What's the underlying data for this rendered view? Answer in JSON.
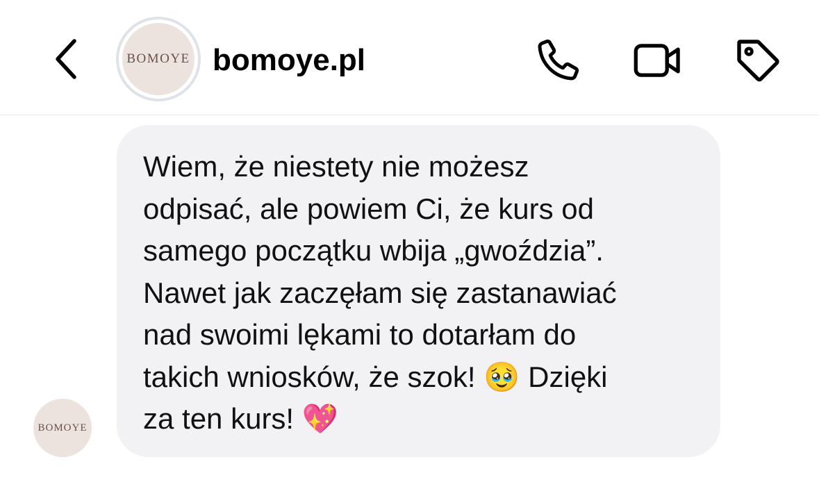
{
  "header": {
    "back_icon": "chevron-left-icon",
    "avatar_logo": "BOMOYE",
    "username": "bomoye.pl",
    "actions": [
      {
        "icon": "phone-icon"
      },
      {
        "icon": "video-camera-icon"
      },
      {
        "icon": "tag-icon"
      }
    ]
  },
  "conversation": {
    "sender_avatar_logo": "BOMOYE",
    "message": {
      "lines": [
        "Wiem, że niestety nie możesz",
        "odpisać, ale powiem Ci, że kurs od",
        "samego początku wbija „gwoździa”.",
        "Nawet jak zaczęłam się zastanawiać",
        "nad swoimi lękami to dotarłam do",
        "takich wniosków, że szok! 🥹 Dzięki",
        "za ten kurs! 💖"
      ]
    }
  }
}
